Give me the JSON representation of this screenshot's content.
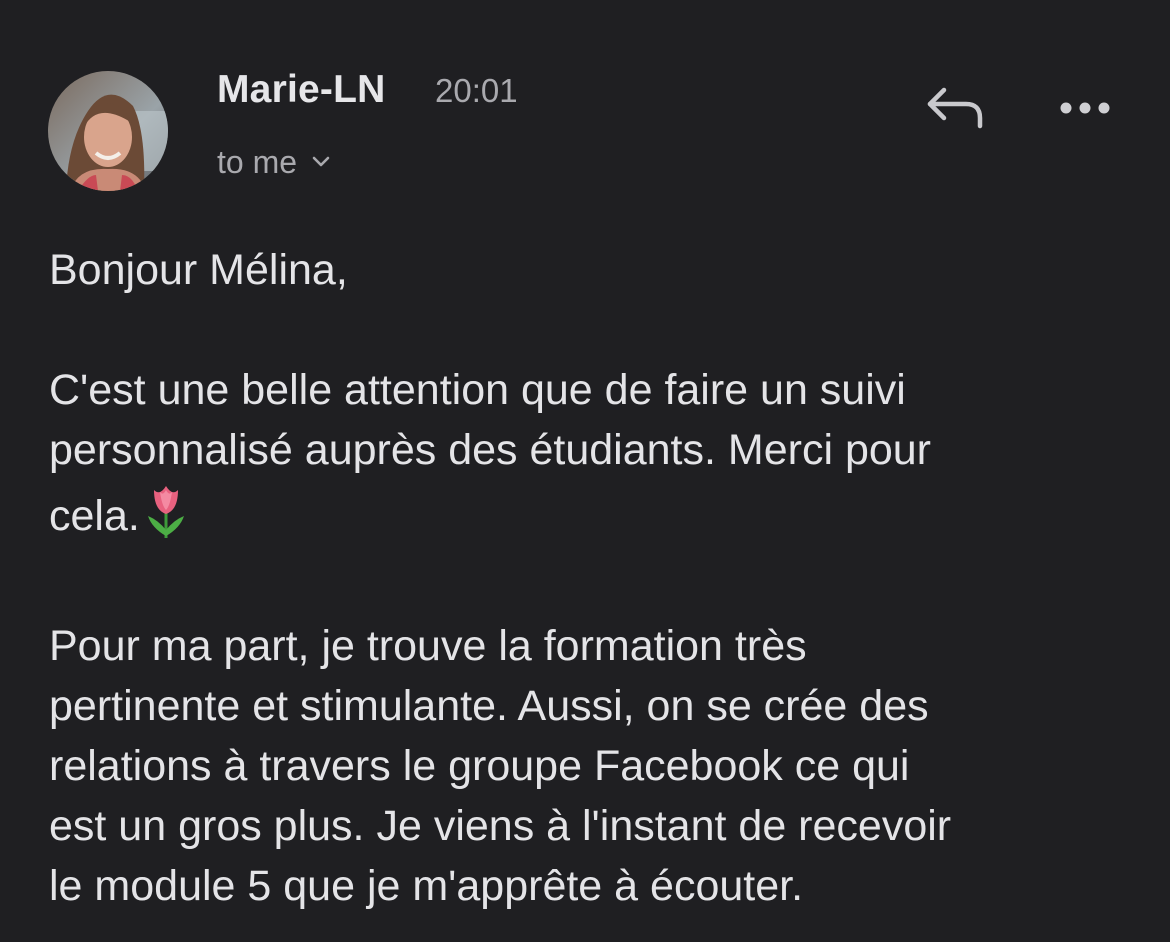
{
  "message": {
    "sender": "Marie-LN",
    "time": "20:01",
    "recipient_label": "to me"
  },
  "icons": {
    "reply": "reply-arrow-icon",
    "more": "more-dots-icon",
    "recipient_toggle": "chevron-down-icon",
    "avatar": "avatar-photo",
    "tulip": "tulip-emoji-icon"
  },
  "colors": {
    "background": "#1f1f22",
    "text": "#e4e4e7",
    "secondary_text": "#a9a9ae"
  },
  "body": {
    "greeting": "Bonjour Mélina,",
    "p1_lines": [
      "C'est une belle attention que de faire un suivi",
      "personnalisé auprès des étudiants. Merci pour",
      "cela."
    ],
    "p2_lines": [
      "Pour ma part, je trouve la formation très",
      "pertinente et stimulante. Aussi, on se crée des",
      "relations à travers le groupe Facebook ce qui",
      "est un gros plus. Je viens à l'instant de recevoir",
      "le module 5 que je m'apprête à écouter."
    ]
  }
}
